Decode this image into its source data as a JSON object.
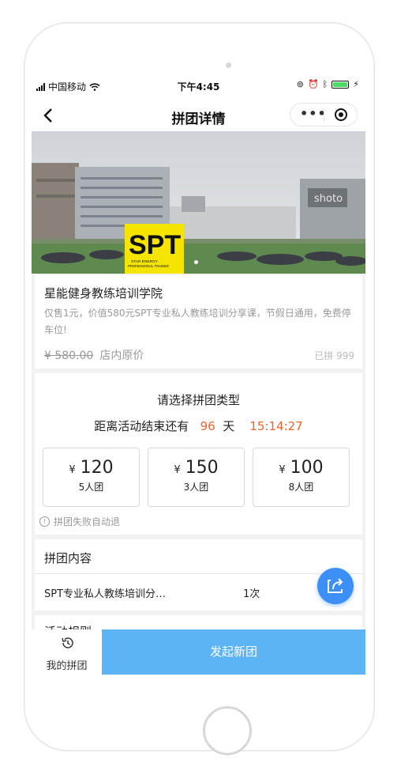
{
  "status_bar": {
    "carrier": "中国移动",
    "time": "下午4:45"
  },
  "nav": {
    "title": "拼团详情",
    "more": "•••"
  },
  "hero": {
    "logo_text": "SPT",
    "logo_sub1": "STAR ENERGY",
    "logo_sub2": "PROFESSIONAL TRAINER",
    "building_sign": "shoto"
  },
  "product": {
    "name": "星能健身教练培训学院",
    "desc": "仅售1元，价值580元SPT专业私人教练培训分享课，节假日通用，免费停车位!",
    "original_price": "¥ 580.00",
    "original_price_label": "店内原价",
    "sold": "已拼 999"
  },
  "group": {
    "title": "请选择拼团类型",
    "countdown_prefix": "距离活动结束还有",
    "days": "96",
    "days_unit": "天",
    "time": "15:14:27",
    "options": [
      {
        "currency": "¥",
        "price": "120",
        "size": "5人团"
      },
      {
        "currency": "¥",
        "price": "150",
        "size": "3人团"
      },
      {
        "currency": "¥",
        "price": "100",
        "size": "8人团"
      }
    ],
    "note": "拼团失败自动退"
  },
  "content": {
    "title": "拼团内容",
    "item": "SPT专业私人教练培训分…",
    "qty": "1次"
  },
  "rules": {
    "title": "活动规则"
  },
  "tabbar": {
    "mine": "我的拼团",
    "start": "发起新团"
  },
  "colors": {
    "accent": "#f0622d",
    "primary": "#5cb4f5",
    "share": "#3b8ff7"
  },
  "icons": [
    "back-arrow-icon",
    "more-icon",
    "target-icon",
    "wifi-icon",
    "battery-icon",
    "share-icon",
    "history-clock-icon",
    "alert-icon"
  ]
}
